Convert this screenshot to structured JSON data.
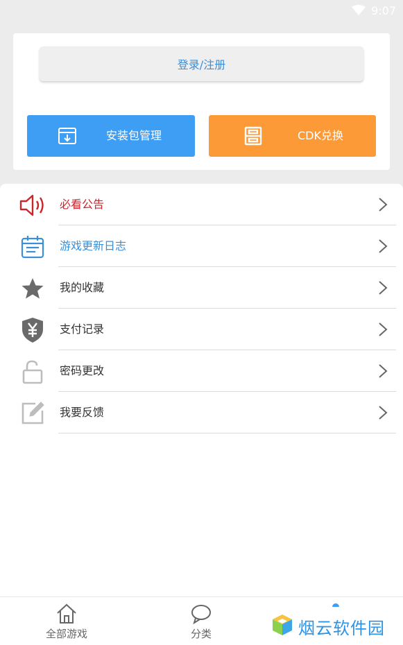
{
  "status_bar": {
    "time": "9:07",
    "icon": "wifi-icon"
  },
  "account": {
    "login_label": "登录/注册"
  },
  "actions": [
    {
      "label": "安装包管理",
      "icon": "package-box-icon",
      "color": "#3e9ef3"
    },
    {
      "label": "CDK兑换",
      "icon": "cdk-card-icon",
      "color": "#fd9a38"
    }
  ],
  "menu": {
    "items": [
      {
        "label": "必看公告",
        "icon": "speaker-icon",
        "color": "#c9252b"
      },
      {
        "label": "游戏更新日志",
        "icon": "calendar-icon",
        "color": "#3a8fd6"
      },
      {
        "label": "我的收藏",
        "icon": "star-icon",
        "color": "#333333"
      },
      {
        "label": "支付记录",
        "icon": "yuan-shield-icon",
        "color": "#333333"
      },
      {
        "label": "密码更改",
        "icon": "unlock-icon",
        "color": "#333333"
      },
      {
        "label": "我要反馈",
        "icon": "edit-icon",
        "color": "#333333"
      }
    ]
  },
  "bottom_nav": {
    "tabs": [
      {
        "label": "全部游戏",
        "icon": "home-icon"
      },
      {
        "label": "分类",
        "icon": "chat-bubble-icon"
      }
    ]
  },
  "watermark": {
    "text": "烟云软件园"
  }
}
